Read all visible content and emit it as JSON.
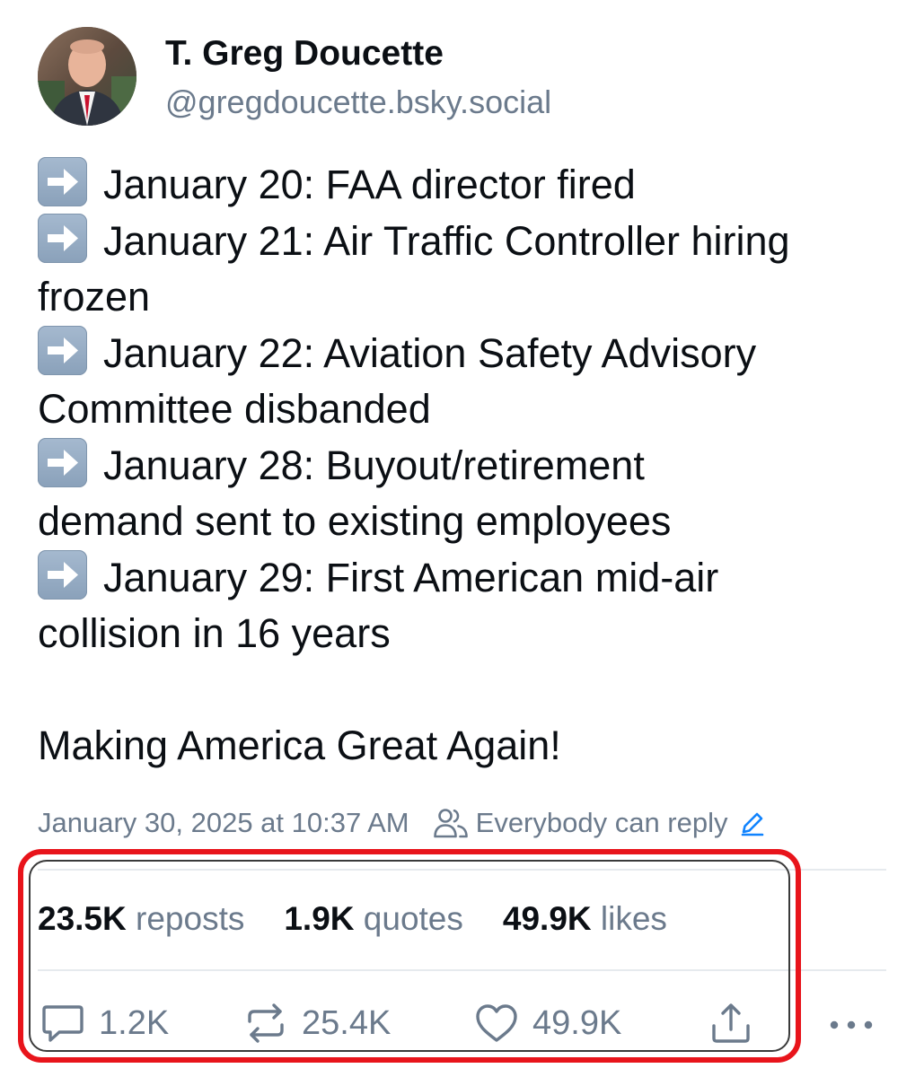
{
  "author": {
    "display_name": "T. Greg Doucette",
    "handle": "@gregdoucette.bsky.social",
    "avatar_icon": "profile-photo"
  },
  "post": {
    "bullet_icon": "right-arrow-emoji",
    "items": [
      {
        "lines": [
          "January 20: FAA director fired"
        ]
      },
      {
        "lines": [
          "January 21: Air Traffic Controller hiring",
          "frozen"
        ]
      },
      {
        "lines": [
          "January 22: Aviation Safety Advisory",
          "Committee disbanded"
        ]
      },
      {
        "lines": [
          "January 28: Buyout/retirement",
          "demand sent to existing employees"
        ]
      },
      {
        "lines": [
          "January 29: First American mid-air",
          "collision in 16 years"
        ]
      }
    ],
    "closing": "Making America Great Again!"
  },
  "meta": {
    "timestamp": "January 30, 2025 at 10:37 AM",
    "reply_setting": "Everybody can reply",
    "reply_setting_icon": "people-icon",
    "edit_icon": "pencil-icon"
  },
  "stats": {
    "reposts_count": "23.5K",
    "reposts_label": "reposts",
    "quotes_count": "1.9K",
    "quotes_label": "quotes",
    "likes_count": "49.9K",
    "likes_label": "likes"
  },
  "actions": {
    "reply_count": "1.2K",
    "repost_count": "25.4K",
    "like_count": "49.9K",
    "share_icon": "share-icon",
    "more_icon": "more-dots-icon"
  },
  "colors": {
    "text": "#0b0f14",
    "muted": "#6b7a8c",
    "accent_blue": "#1083fe",
    "highlight_red": "#e8141b"
  }
}
